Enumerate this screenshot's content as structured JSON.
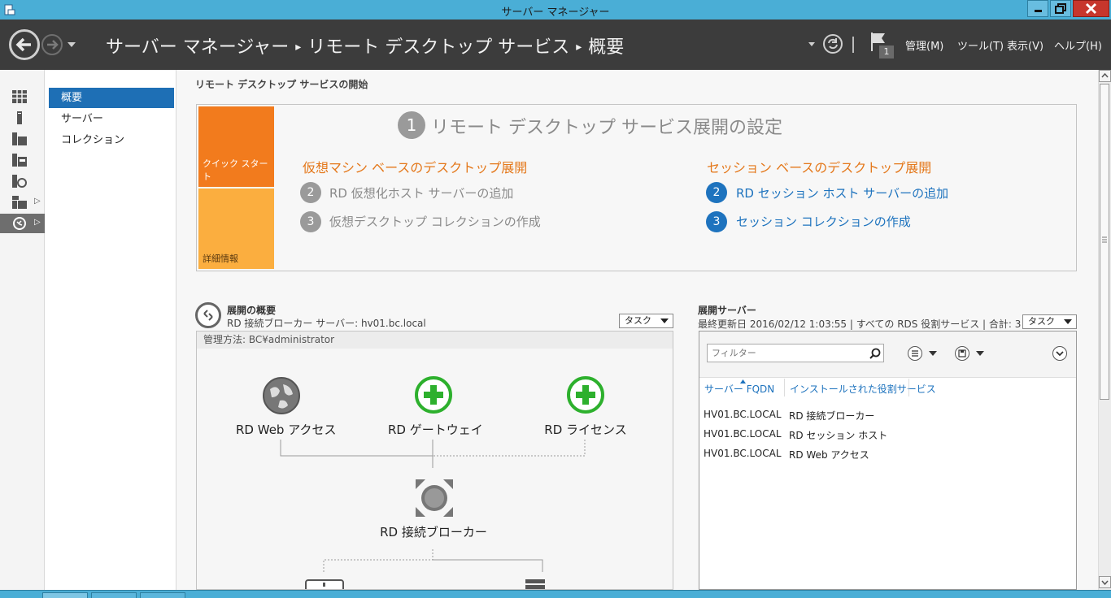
{
  "window": {
    "title": "サーバー マネージャー"
  },
  "header": {
    "breadcrumb": [
      "サーバー マネージャー",
      "リモート デスクトップ サービス",
      "概要"
    ],
    "separator": "▸",
    "flag_count": "1",
    "menus": [
      "管理(M)",
      "ツール(T)",
      "表示(V)",
      "ヘルプ(H)"
    ]
  },
  "icon_strip": [
    {
      "name": "dashboard-icon"
    },
    {
      "name": "local-server-icon"
    },
    {
      "name": "all-servers-icon"
    },
    {
      "name": "file-storage-icon"
    },
    {
      "name": "iis-icon"
    },
    {
      "name": "server-group-icon"
    },
    {
      "name": "remote-desktop-icon"
    }
  ],
  "subnav": {
    "items": [
      "概要",
      "サーバー",
      "コレクション"
    ],
    "active_index": 0
  },
  "main": {
    "section_title": "リモート デスクトップ サービスの開始",
    "quick_start": {
      "tab_quick": "クイック スタート",
      "tab_details": "詳細情報",
      "step1_num": "1",
      "heading": "リモート デスクトップ サービス展開の設定",
      "vm_title": "仮想マシン ベースのデスクトップ展開",
      "vm_steps": [
        {
          "num": "2",
          "text": "RD 仮想化ホスト サーバーの追加"
        },
        {
          "num": "3",
          "text": "仮想デスクトップ コレクションの作成"
        }
      ],
      "session_title": "セッション ベースのデスクトップ展開",
      "session_steps": [
        {
          "num": "2",
          "text": "RD セッション ホスト サーバーの追加"
        },
        {
          "num": "3",
          "text": "セッション コレクションの作成"
        }
      ]
    },
    "deployment_overview": {
      "title": "展開の概要",
      "subtitle": "RD 接続ブローカー サーバー: hv01.bc.local",
      "task_label": "タスク",
      "manage_label": "管理方法: BC¥administrator",
      "roles": {
        "web_access": "RD Web アクセス",
        "gateway": "RD ゲートウェイ",
        "licensing": "RD ライセンス",
        "broker": "RD 接続ブローカー"
      }
    },
    "deployment_servers": {
      "title": "展開サーバー",
      "subtitle": "最終更新日 2016/02/12 1:03:55 | すべての RDS 役割サービス | 合計: 3",
      "task_label": "タスク",
      "filter_placeholder": "フィルター",
      "columns": [
        "サーバー FQDN",
        "インストールされた役割サービス"
      ],
      "rows": [
        {
          "fqdn": "HV01.BC.LOCAL",
          "role": "RD 接続ブローカー"
        },
        {
          "fqdn": "HV01.BC.LOCAL",
          "role": "RD セッション ホスト"
        },
        {
          "fqdn": "HV01.BC.LOCAL",
          "role": "RD Web アクセス"
        }
      ]
    }
  },
  "colors": {
    "header_bg": "#3c3c3c",
    "titlebar_bg": "#4aaed6",
    "quick_start_orange": "#f27b1d",
    "details_orange": "#fbae3f",
    "link_blue": "#1e73be",
    "add_green": "#2db02d",
    "nav_active": "#1e6fb5"
  }
}
